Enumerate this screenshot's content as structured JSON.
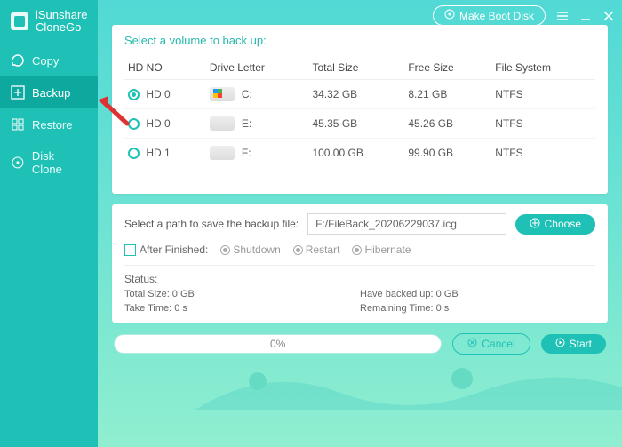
{
  "brand": {
    "line1": "iSunshare",
    "line2": "CloneGo"
  },
  "topbar": {
    "make_boot": "Make Boot Disk"
  },
  "sidebar": {
    "items": [
      {
        "label": "Copy"
      },
      {
        "label": "Backup"
      },
      {
        "label": "Restore"
      },
      {
        "label": "Disk Clone"
      }
    ]
  },
  "volumes": {
    "title": "Select a volume to back up:",
    "headers": {
      "hdno": "HD NO",
      "drive": "Drive Letter",
      "total": "Total Size",
      "free": "Free Size",
      "fs": "File System"
    },
    "rows": [
      {
        "hd": "HD 0",
        "letter": "C:",
        "total": "34.32 GB",
        "free": "8.21 GB",
        "fs": "NTFS",
        "win": true,
        "selected": true
      },
      {
        "hd": "HD 0",
        "letter": "E:",
        "total": "45.35 GB",
        "free": "45.26 GB",
        "fs": "NTFS",
        "win": false,
        "selected": false
      },
      {
        "hd": "HD 1",
        "letter": "F:",
        "total": "100.00 GB",
        "free": "99.90 GB",
        "fs": "NTFS",
        "win": false,
        "selected": false
      }
    ]
  },
  "save": {
    "label": "Select a path to save the backup file:",
    "path": "F:/FileBack_20206229037.icg",
    "choose": "Choose"
  },
  "after": {
    "label": "After Finished:",
    "opts": {
      "shutdown": "Shutdown",
      "restart": "Restart",
      "hibernate": "Hibernate"
    }
  },
  "status": {
    "title": "Status:",
    "total": "Total Size: 0 GB",
    "backed": "Have backed up: 0 GB",
    "take": "Take Time: 0 s",
    "remain": "Remaining Time: 0 s"
  },
  "bottom": {
    "progress": "0%",
    "cancel": "Cancel",
    "start": "Start"
  }
}
